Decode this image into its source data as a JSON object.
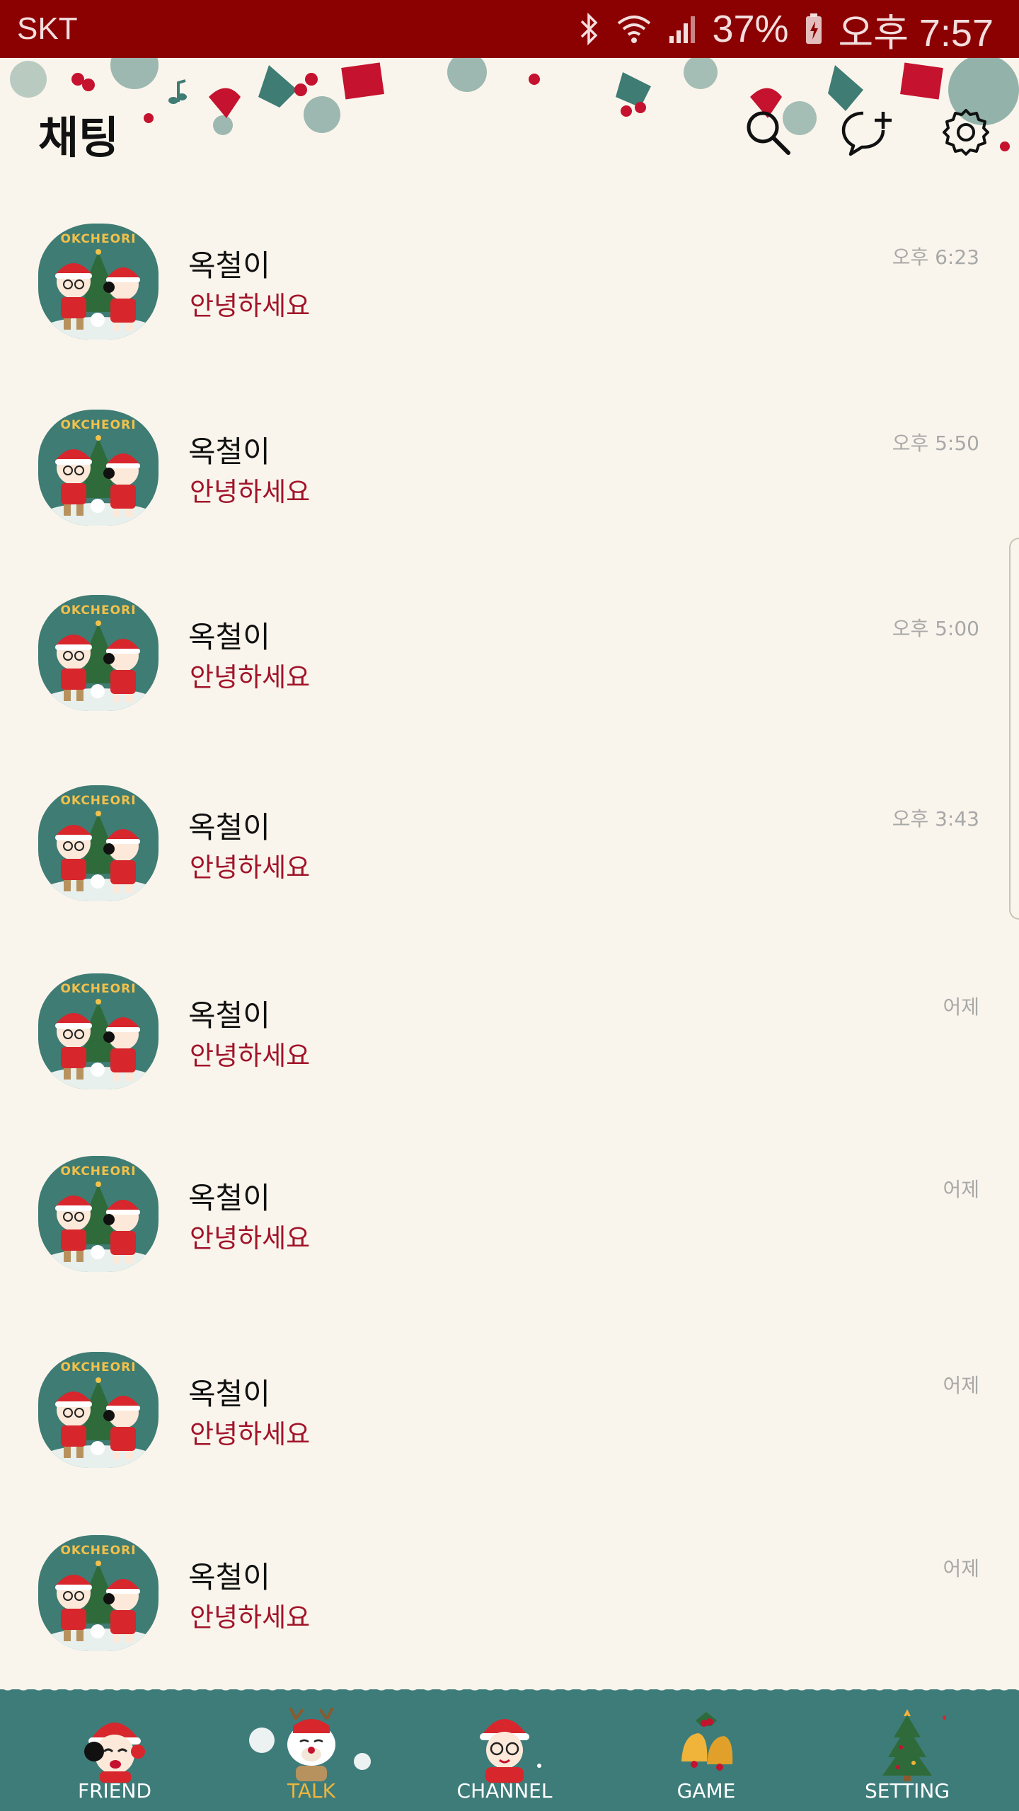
{
  "status_bar": {
    "carrier": "SKT",
    "battery": "37%",
    "time": "오후 7:57"
  },
  "header": {
    "title": "채팅",
    "icons": [
      "search-icon",
      "new-chat-icon",
      "settings-icon"
    ]
  },
  "chats": [
    {
      "name": "옥철이",
      "message": "안녕하세요",
      "time": "오후 6:23",
      "avatar_text": "OKCHEORI"
    },
    {
      "name": "옥철이",
      "message": "안녕하세요",
      "time": "오후 5:50",
      "avatar_text": "OKCHEORI"
    },
    {
      "name": "옥철이",
      "message": "안녕하세요",
      "time": "오후 5:00",
      "avatar_text": "OKCHEORI"
    },
    {
      "name": "옥철이",
      "message": "안녕하세요",
      "time": "오후 3:43",
      "avatar_text": "OKCHEORI"
    },
    {
      "name": "옥철이",
      "message": "안녕하세요",
      "time": "어제",
      "avatar_text": "OKCHEORI"
    },
    {
      "name": "옥철이",
      "message": "안녕하세요",
      "time": "어제",
      "avatar_text": "OKCHEORI"
    },
    {
      "name": "옥철이",
      "message": "안녕하세요",
      "time": "어제",
      "avatar_text": "OKCHEORI"
    },
    {
      "name": "옥철이",
      "message": "안녕하세요",
      "time": "어제",
      "avatar_text": "OKCHEORI"
    }
  ],
  "bottom_nav": [
    {
      "label": "FRIEND",
      "icon": "santa-girl-icon",
      "active": false
    },
    {
      "label": "TALK",
      "icon": "reindeer-icon",
      "active": true
    },
    {
      "label": "CHANNEL",
      "icon": "santa-boy-icon",
      "active": false
    },
    {
      "label": "GAME",
      "icon": "bells-icon",
      "active": false
    },
    {
      "label": "SETTING",
      "icon": "christmas-tree-icon",
      "active": false
    }
  ],
  "colors": {
    "status_bar": "#8b0000",
    "background": "#faf5ec",
    "message_text": "#a0142a",
    "nav_background": "#3e7c7a",
    "nav_active": "#f0b43a",
    "avatar_bg": "#3e7c74"
  }
}
